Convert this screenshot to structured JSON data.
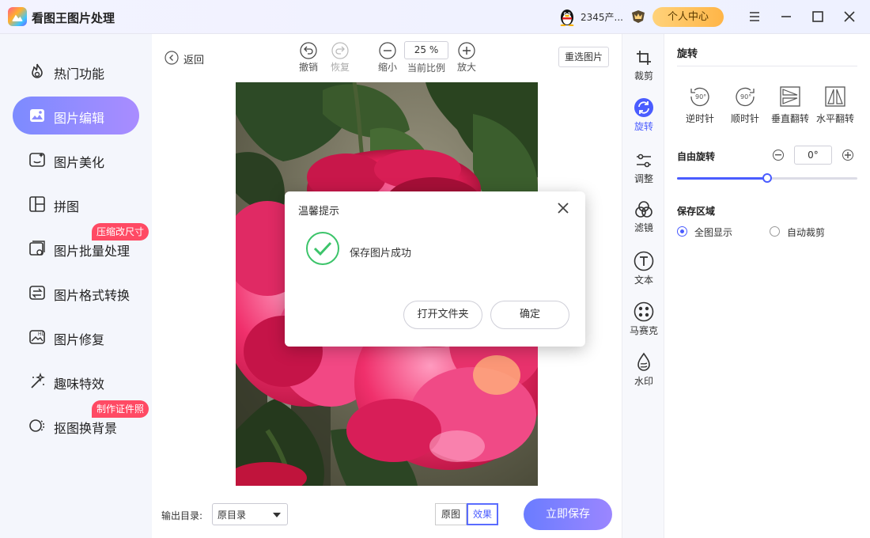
{
  "app": {
    "title": "看图王图片处理"
  },
  "titlebar": {
    "user_name": "2345产...",
    "user_center": "个人中心"
  },
  "sidebar": {
    "items": [
      {
        "label": "热门功能",
        "icon": "flame-icon"
      },
      {
        "label": "图片编辑",
        "icon": "image-edit-icon",
        "active": true
      },
      {
        "label": "图片美化",
        "icon": "image-beautify-icon"
      },
      {
        "label": "拼图",
        "icon": "collage-icon"
      },
      {
        "label": "图片批量处理",
        "icon": "batch-icon",
        "badge": "压缩改尺寸"
      },
      {
        "label": "图片格式转换",
        "icon": "convert-icon"
      },
      {
        "label": "图片修复",
        "icon": "hd-repair-icon"
      },
      {
        "label": "趣味特效",
        "icon": "magic-wand-icon"
      },
      {
        "label": "抠图换背景",
        "icon": "cutout-icon",
        "badge": "制作证件照"
      }
    ]
  },
  "toolbar": {
    "back": "返回",
    "undo": "撤销",
    "redo": "恢复",
    "zoom_out": "缩小",
    "zoom_value": "25 %",
    "zoom_label": "当前比例",
    "zoom_in": "放大",
    "reselect": "重选图片"
  },
  "footer": {
    "output_label": "输出目录:",
    "output_value": "原目录",
    "original": "原图",
    "effect": "效果",
    "save_now": "立即保存"
  },
  "rail": {
    "items": [
      {
        "label": "裁剪"
      },
      {
        "label": "旋转",
        "active": true
      },
      {
        "label": "调整"
      },
      {
        "label": "滤镜"
      },
      {
        "label": "文本"
      },
      {
        "label": "马赛克"
      },
      {
        "label": "水印"
      }
    ]
  },
  "panel": {
    "title": "旋转",
    "rotate_buttons": [
      {
        "label": "逆时针",
        "badge": "90°"
      },
      {
        "label": "顺时针",
        "badge": "90°"
      },
      {
        "label": "垂直翻转"
      },
      {
        "label": "水平翻转"
      }
    ],
    "free_rotate": "自由旋转",
    "degree": "0°",
    "slider_fraction": 0.5,
    "save_area": "保存区域",
    "options": [
      {
        "label": "全图显示",
        "selected": true
      },
      {
        "label": "自动裁剪",
        "selected": false
      }
    ]
  },
  "dialog": {
    "title": "温馨提示",
    "message": "保存图片成功",
    "open_folder": "打开文件夹",
    "ok": "确定"
  },
  "colors": {
    "accent": "#4a5cff",
    "active_gradient_start": "#7c8bff",
    "active_gradient_end": "#a98cff",
    "badge": "#ff4a64",
    "success": "#3cc46a"
  }
}
